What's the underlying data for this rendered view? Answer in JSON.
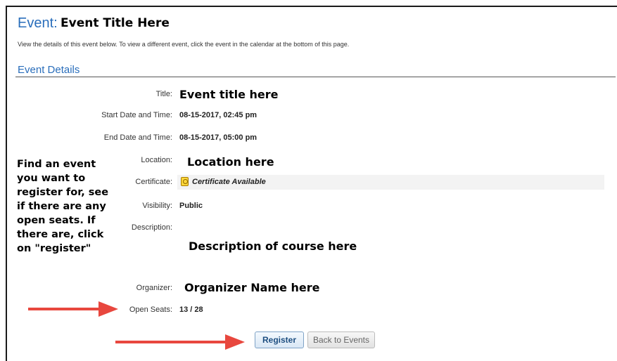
{
  "header": {
    "prefix": "Event:",
    "title": "Event Title Here"
  },
  "intro": "View the details of this event below. To view a different event, click the event in the calendar at the bottom of this page.",
  "section_title": "Event Details",
  "fields": {
    "title": {
      "label": "Title:",
      "value": "Event title here"
    },
    "start": {
      "label": "Start Date and Time:",
      "value": "08-15-2017, 02:45 pm"
    },
    "end": {
      "label": "End Date and Time:",
      "value": "08-15-2017, 05:00 pm"
    },
    "location": {
      "label": "Location:",
      "value": "Location here"
    },
    "certificate": {
      "label": "Certificate:",
      "value": "Certificate Available"
    },
    "visibility": {
      "label": "Visibility:",
      "value": "Public"
    },
    "description": {
      "label": "Description:",
      "value": "Description of course here"
    },
    "organizer": {
      "label": "Organizer:",
      "value": "Organizer Name here"
    },
    "open_seats": {
      "label": "Open Seats:",
      "value": "13 / 28"
    }
  },
  "annotation": "Find an event you want to register for, see if there are any open seats. If there are, click on \"register\"",
  "buttons": {
    "register": "Register",
    "back": "Back to Events"
  },
  "colors": {
    "accent": "#2a6ebb",
    "arrow": "#e8473e",
    "cert_badge": "#ffd83a"
  },
  "icons": {
    "certificate": "certificate-badge-icon",
    "arrow": "red-arrow-icon"
  }
}
